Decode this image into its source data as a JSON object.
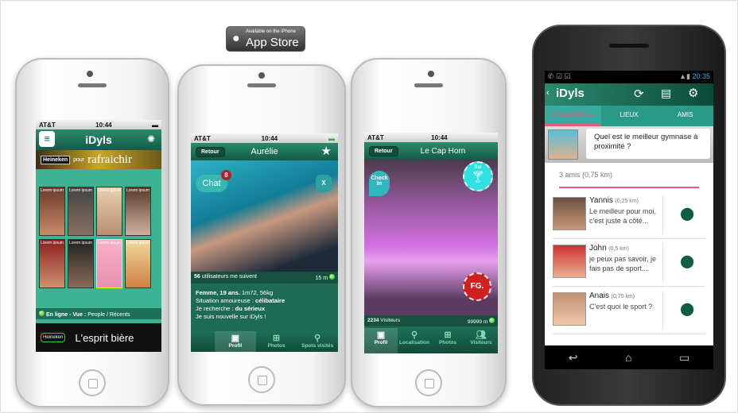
{
  "appstore": {
    "small": "Available on the iPhone",
    "big": "App Store"
  },
  "phone1": {
    "carrier": "AT&T",
    "time": "10:44",
    "logo": "iDyls",
    "banner": {
      "brand": "Heineken",
      "pour": "pour",
      "word": "rafraichir"
    },
    "tile_label": "Lorem ipsum",
    "status_line": {
      "bold": "En ligne - Vue :",
      "rest": "People / Récents"
    },
    "ad": {
      "brand": "Heineken",
      "text": "L'esprit bière"
    }
  },
  "phone2": {
    "carrier": "AT&T",
    "time": "10:44",
    "back": "Retour",
    "title": "Aurélie",
    "chat": "Chat",
    "chat_badge": "8",
    "close": "X",
    "followers": {
      "count": "56",
      "text": "utilisateurs me suivent"
    },
    "distance": "15 m",
    "bio": [
      {
        "bold": "Femme, 19 ans.",
        "rest": " 1m72, 56kg"
      },
      {
        "rest": "Situation amoureuse : ",
        "bold": "célibataire"
      },
      {
        "rest": "Je recherche : ",
        "bold": "du sérieux"
      },
      {
        "rest": "Je suis nouvelle sur iDyls !"
      }
    ],
    "tabs": [
      {
        "label": "Profil",
        "icon": "id-card-icon"
      },
      {
        "label": "Photos",
        "icon": "grid-icon"
      },
      {
        "label": "Spots visités",
        "icon": "pin-icon"
      }
    ]
  },
  "phone3": {
    "carrier": "AT&T",
    "time": "10:44",
    "back": "Retour",
    "title": "Le Cap Horn",
    "checkin": "Check In",
    "bar": "Bar",
    "fg": "FG.",
    "visitors": {
      "count": "2234",
      "text": "Visiteurs"
    },
    "distance": "99999 m",
    "tabs": [
      {
        "label": "Profil",
        "icon": "id-card-icon"
      },
      {
        "label": "Localisation",
        "icon": "pin-icon"
      },
      {
        "label": "Photos",
        "icon": "grid-icon"
      },
      {
        "label": "Visiteurs",
        "icon": "people-icon"
      }
    ]
  },
  "android": {
    "time": "20:35",
    "logo": "iDyls",
    "tabs": [
      "PERSONNES",
      "LIEUX",
      "AMIS"
    ],
    "question": "Quel est le meilleur gymnase à proximité ?",
    "count": "3 amis (0,75 km)",
    "accent": "#f0557a",
    "items": [
      {
        "name": "Yannis",
        "dist": "(0,25 km)",
        "msg": "Le meilleur pour moi, c'est juste à côté..."
      },
      {
        "name": "John",
        "dist": "(0,5 km)",
        "msg": "je peux pas savoir, je fais pas de sport..."
      },
      {
        "name": "Anais",
        "dist": "(0,75 km)",
        "msg": "C'est quoi le sport ?"
      }
    ]
  }
}
